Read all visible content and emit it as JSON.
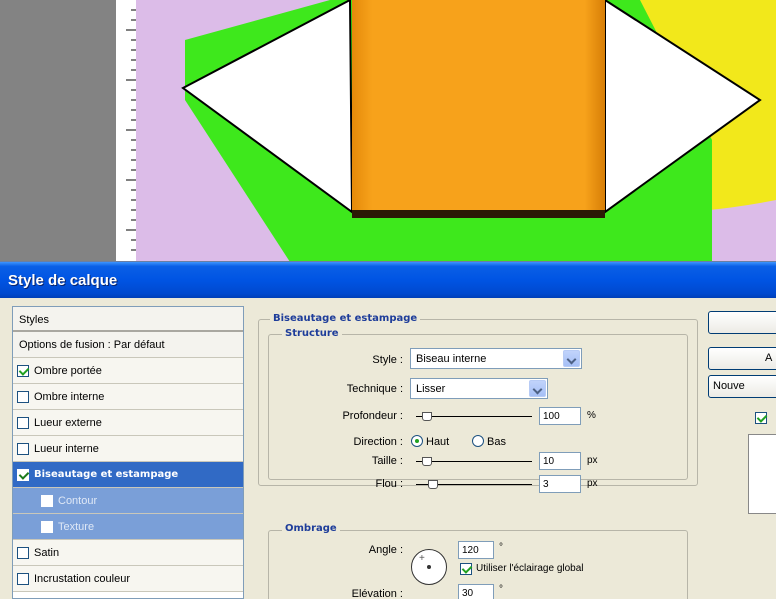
{
  "dialog": {
    "title": "Style de calque"
  },
  "style_list": {
    "header": "Styles",
    "options_row": "Options de fusion : Par défaut",
    "items": [
      {
        "label": "Ombre portée",
        "checked": true
      },
      {
        "label": "Ombre interne",
        "checked": false
      },
      {
        "label": "Lueur externe",
        "checked": false
      },
      {
        "label": "Lueur interne",
        "checked": false
      },
      {
        "label": "Biseautage et estampage",
        "checked": true,
        "selected": true
      },
      {
        "label": "Contour",
        "checked": false
      },
      {
        "label": "Texture",
        "checked": false
      },
      {
        "label": "Satin",
        "checked": false
      },
      {
        "label": "Incrustation couleur",
        "checked": false
      }
    ]
  },
  "bevel": {
    "section_title": "Biseautage et estampage",
    "structure_title": "Structure",
    "style_label": "Style :",
    "style_value": "Biseau interne",
    "technique_label": "Technique :",
    "technique_value": "Lisser",
    "depth_label": "Profondeur :",
    "depth_value": "100",
    "depth_unit": "%",
    "direction_label": "Direction :",
    "direction_up": "Haut",
    "direction_down": "Bas",
    "size_label": "Taille :",
    "size_value": "10",
    "size_unit": "px",
    "soften_label": "Flou :",
    "soften_value": "3",
    "soften_unit": "px"
  },
  "shading": {
    "section_title": "Ombrage",
    "angle_label": "Angle :",
    "angle_value": "120",
    "angle_unit": "°",
    "global_light_label": "Utiliser l'éclairage global",
    "altitude_label": "Elévation :",
    "altitude_value": "30",
    "altitude_unit": "°"
  },
  "buttons": {
    "ok": "",
    "cancel": "A",
    "new_style": "Nouve"
  },
  "colors": {
    "titlebar": "#0054e3",
    "selection": "#316ac5",
    "canvas_orange": "#f7a21b",
    "canvas_green": "#3ee81c",
    "canvas_yellow": "#f2e81b",
    "canvas_lilac": "#dcbce8"
  },
  "icons": {
    "checkbox": "checkbox-icon",
    "dropdown": "chevron-down-icon",
    "radio": "radio-icon",
    "angle": "angle-dial-icon"
  }
}
